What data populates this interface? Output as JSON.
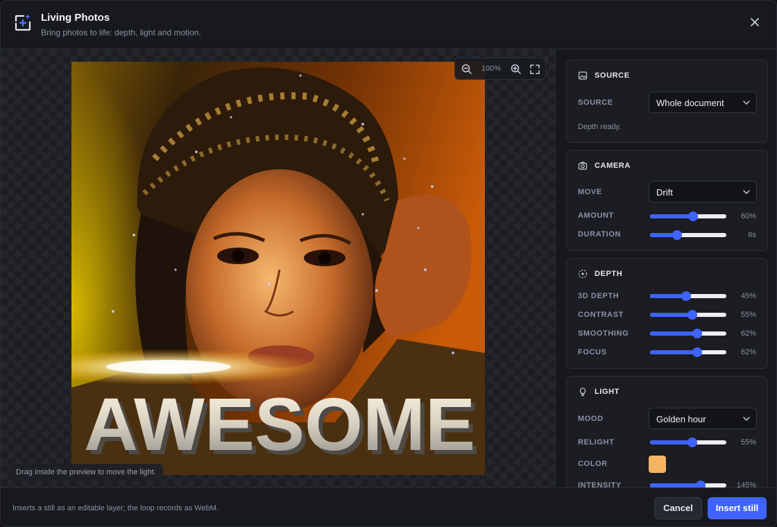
{
  "header": {
    "title": "Living Photos",
    "subtitle": "Bring photos to life: depth, light and motion.",
    "icon": "living-photos-icon",
    "close_icon": "close-icon"
  },
  "preview": {
    "zoom_level": "100%",
    "hint": "Drag inside the preview to move the light.",
    "overlay_text": "AWESOME"
  },
  "source": {
    "title": "SOURCE",
    "label": "SOURCE",
    "value": "Whole document",
    "status": "Depth ready."
  },
  "camera": {
    "title": "CAMERA",
    "move_label": "MOVE",
    "move_value": "Drift",
    "amount_label": "AMOUNT",
    "amount_value": "60%",
    "amount_level": 0.56,
    "duration_label": "DURATION",
    "duration_value": "6s",
    "duration_level": 0.35
  },
  "depth": {
    "title": "DEPTH",
    "depth_label": "3D DEPTH",
    "depth_value": "45%",
    "depth_level": 0.47,
    "contrast_label": "CONTRAST",
    "contrast_value": "55%",
    "contrast_level": 0.55,
    "smoothing_label": "SMOOTHING",
    "smoothing_value": "62%",
    "smoothing_level": 0.62,
    "focus_label": "FOCUS",
    "focus_value": "62%",
    "focus_level": 0.62
  },
  "light": {
    "title": "LIGHT",
    "mood_label": "MOOD",
    "mood_value": "Golden hour",
    "relight_label": "RELIGHT",
    "relight_value": "55%",
    "relight_level": 0.55,
    "color_label": "COLOR",
    "color_value": "#f5b461",
    "intensity_label": "INTENSITY",
    "intensity_value": "145%",
    "intensity_level": 0.66
  },
  "footer": {
    "note": "Inserts a still as an editable layer; the loop records as WebM.",
    "cancel_label": "Cancel",
    "insert_label": "Insert still"
  },
  "colors": {
    "accent": "#3f63ff",
    "background": "#16181d"
  }
}
